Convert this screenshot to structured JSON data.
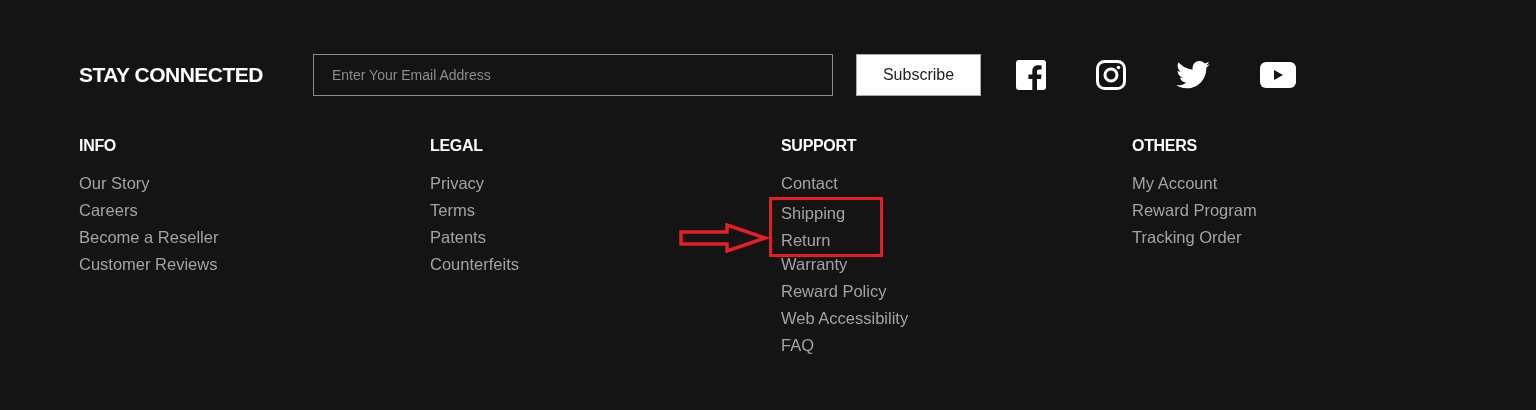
{
  "newsletter": {
    "heading": "STAY CONNECTED",
    "email_field": {
      "placeholder": "Enter Your Email Address"
    },
    "button": "Subscribe"
  },
  "social_icons": [
    {
      "kind": "facebook"
    },
    {
      "kind": "instagram"
    },
    {
      "kind": "twitter"
    },
    {
      "kind": "youtube"
    }
  ],
  "columns": [
    {
      "heading": "INFO",
      "links": [
        {
          "label": "Our Story",
          "highlighted": false
        },
        {
          "label": "Careers",
          "highlighted": false
        },
        {
          "label": "Become a Reseller",
          "highlighted": false
        },
        {
          "label": "Customer Reviews",
          "highlighted": false
        }
      ]
    },
    {
      "heading": "LEGAL",
      "links": [
        {
          "label": "Privacy",
          "highlighted": false
        },
        {
          "label": "Terms",
          "highlighted": false
        },
        {
          "label": "Patents",
          "highlighted": false
        },
        {
          "label": "Counterfeits",
          "highlighted": false
        }
      ]
    },
    {
      "heading": "SUPPORT",
      "links": [
        {
          "label": "Contact",
          "highlighted": false
        },
        {
          "label": "Shipping",
          "highlighted": true
        },
        {
          "label": "Return",
          "highlighted": true
        },
        {
          "label": "Warranty",
          "highlighted": false
        },
        {
          "label": "Reward Policy",
          "highlighted": false
        },
        {
          "label": "Web Accessibility",
          "highlighted": false
        },
        {
          "label": "FAQ",
          "highlighted": false
        }
      ]
    },
    {
      "heading": "OTHERS",
      "links": [
        {
          "label": "My Account",
          "highlighted": false
        },
        {
          "label": "Reward Program",
          "highlighted": false
        },
        {
          "label": "Tracking Order",
          "highlighted": false
        }
      ]
    }
  ]
}
